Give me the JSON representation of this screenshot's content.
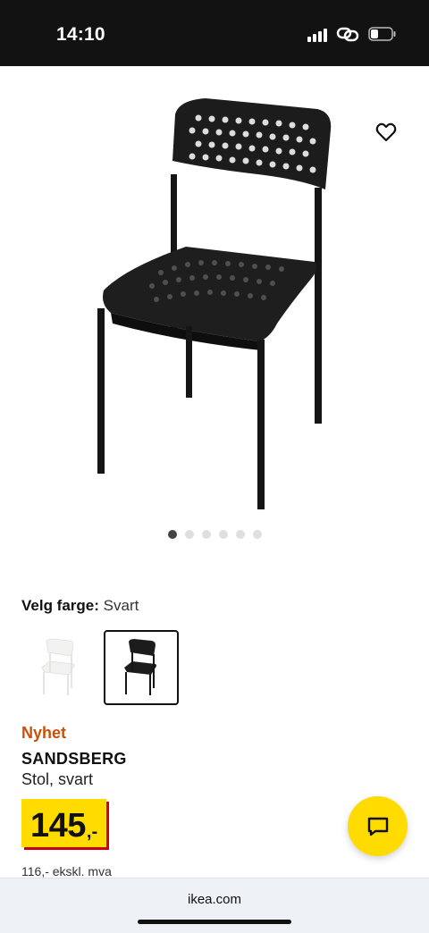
{
  "status_bar": {
    "time": "14:10"
  },
  "product": {
    "image_icon": "adde-chair-black-photo",
    "favorite_icon": "heart-outline-icon",
    "carousel": {
      "total": 6,
      "active_index": 0
    },
    "color_label": "Velg farge:",
    "color_value": "Svart",
    "swatches": [
      {
        "name": "white-chair-swatch",
        "color": "#f4f4f2",
        "selected": false
      },
      {
        "name": "black-chair-swatch",
        "color": "#1a1a1a",
        "selected": true
      }
    ],
    "badge": "Nyhet",
    "name": "SANDSBERG",
    "description": "Stol, svart",
    "price_integer": "145",
    "price_decimals": ",-",
    "price_ex_vat": "116,- ekskl. mva"
  },
  "chat_button": {
    "icon": "chat-bubble-icon"
  },
  "browser": {
    "url": "ikea.com"
  },
  "colors": {
    "ikea_yellow": "#ffdb00",
    "accent_red": "#cc0008",
    "news_orange": "#ca5008"
  }
}
